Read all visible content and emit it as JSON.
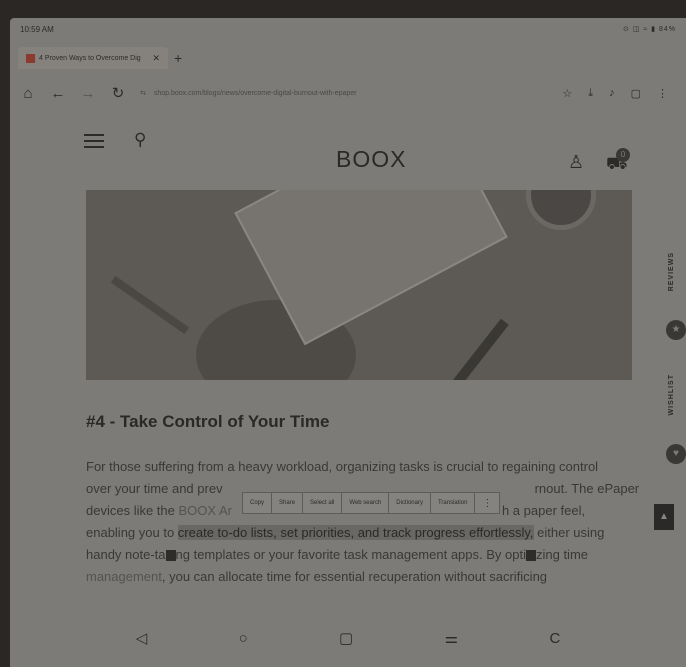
{
  "status": {
    "time": "10:59 AM",
    "indicators": "⊙ ◫ ≈ ▮ 84%"
  },
  "tab": {
    "title": "4 Proven Ways to Overcome Dig",
    "close": "✕",
    "new": "+"
  },
  "address": {
    "url": "shop.boox.com/blogs/news/overcome-digital-burnout-with-epaper",
    "site_info": "⇆"
  },
  "site": {
    "logo": "BOOX",
    "cart_count": "0"
  },
  "article": {
    "heading": "#4 - Take Control of Your Time",
    "p1a": "For those suffering from a heavy workload, organizing tasks is crucial to regaining control",
    "p2a": "over your time and prev",
    "p2b": "rnout. The ePaper",
    "p3a": "devices like the ",
    "p3link": "BOOX Ar",
    "p3b": "h a paper feel,",
    "p4a": "enabling you to ",
    "p4hl": "create to-do lists, set priorities, and track progress effortlessly,",
    "p4b": " either using",
    "p5a": "handy note-ta",
    "p5b": "ng templates or your favorite task management apps. By opti",
    "p5c": "zing time",
    "p6a": "management",
    "p6b": ", you can allocate time for essential recuperation without sacrificing"
  },
  "popup": {
    "items": [
      "Copy",
      "Share",
      "Select all",
      "Web search",
      "Dictionary",
      "Translation",
      "⋮"
    ]
  },
  "side": {
    "reviews": "REVIEWS",
    "wishlist": "WISHLIST"
  },
  "nav": {
    "back": "◁",
    "home": "○",
    "recents": "▢",
    "settings": "⚌",
    "refresh": "C"
  }
}
